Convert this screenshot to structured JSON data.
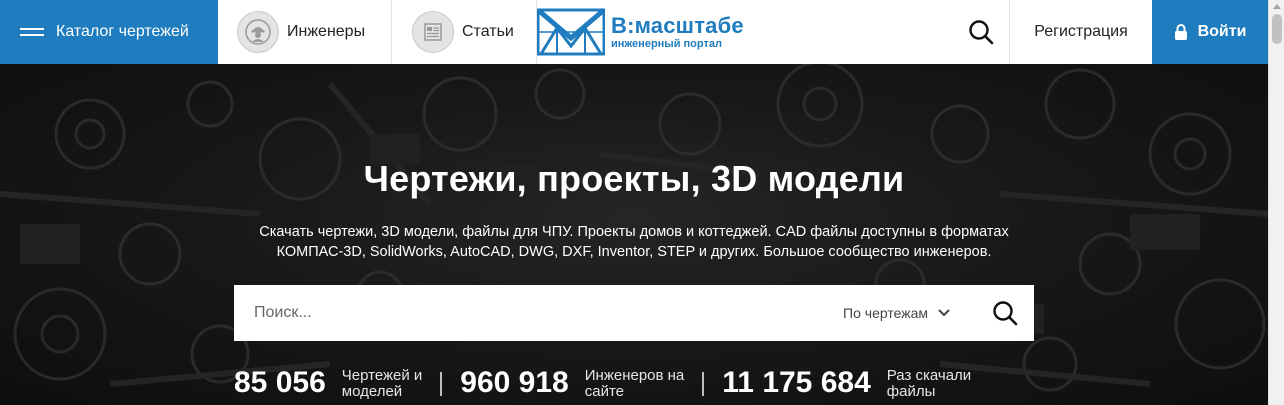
{
  "header": {
    "catalog_label": "Каталог чертежей",
    "engineers_label": "Инженеры",
    "articles_label": "Статьи",
    "logo_title": "В:масштабе",
    "logo_subtitle": "инженерный портал",
    "register_label": "Регистрация",
    "login_label": "Войти"
  },
  "hero": {
    "title": "Чертежи, проекты, 3D модели",
    "description_line1": "Скачать чертежи, 3D модели, файлы для ЧПУ. Проекты домов и коттеджей. CAD файлы доступны в форматах",
    "description_line2": "КОМПАС-3D, SolidWorks, AutoCAD, DWG, DXF, Inventor, STEP и других. Большое сообщество инженеров."
  },
  "search": {
    "placeholder": "Поиск...",
    "value": "",
    "filter_selected": "По чертежам"
  },
  "stats": [
    {
      "number": "85 056",
      "label_line1": "Чертежей и",
      "label_line2": "моделей"
    },
    {
      "number": "960 918",
      "label_line1": "Инженеров на",
      "label_line2": "сайте"
    },
    {
      "number": "11 175 684",
      "label_line1": "Раз скачали",
      "label_line2": "файлы"
    }
  ],
  "colors": {
    "brand_blue": "#1f7cbe",
    "hero_text": "#ffffff"
  },
  "icons": {
    "menu": "hamburger-icon",
    "engineers": "engineer-avatar-icon",
    "articles": "article-icon",
    "search": "search-icon",
    "login": "lock-icon",
    "filter": "chevron-down-icon"
  }
}
